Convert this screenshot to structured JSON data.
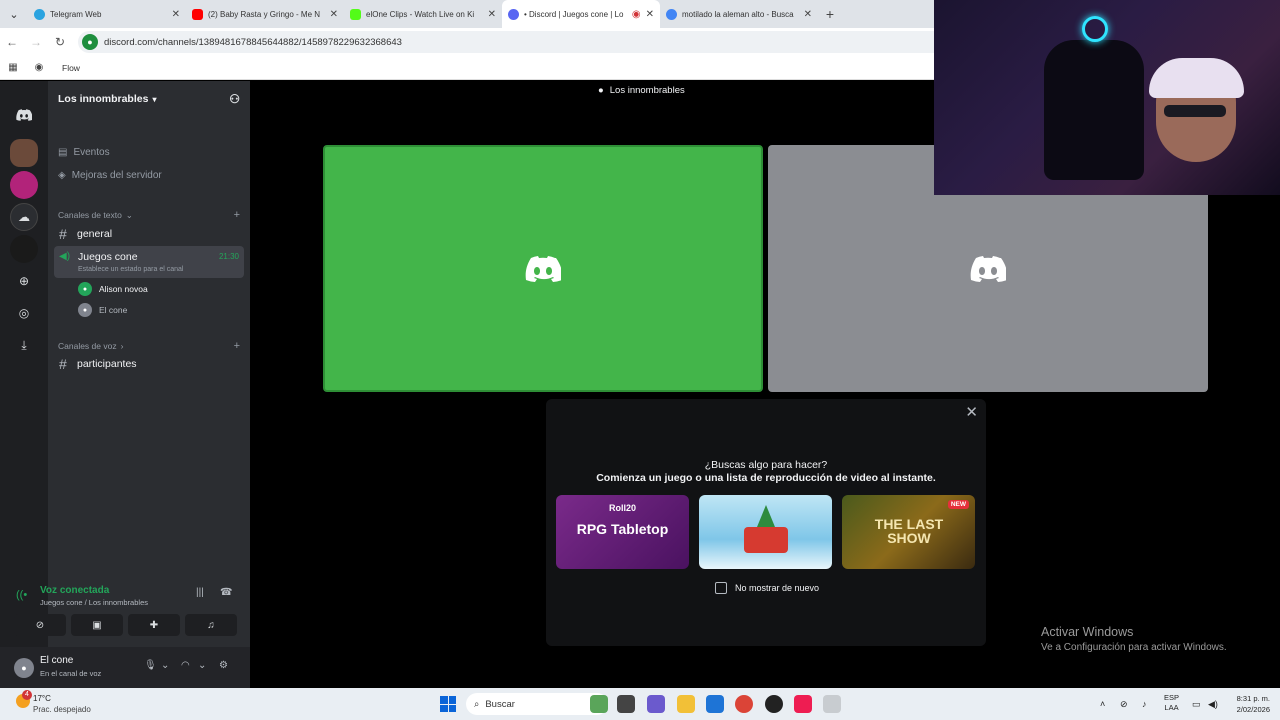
{
  "browser": {
    "tabs": [
      {
        "title": "Telegram Web",
        "color": "#2aa3e0"
      },
      {
        "title": "(2) Baby Rasta y Gringo - Me N",
        "color": "#ff0000"
      },
      {
        "title": "elOne Clips - Watch Live on Ki",
        "color": "#53fc18"
      },
      {
        "title": "• Discord | Juegos cone | Lo",
        "color": "#5865f2"
      },
      {
        "title": "motilado la aleman alto - Busca",
        "color": "#4285f4"
      }
    ],
    "url": "discord.com/channels/1389481678845644882/1458978229632368643",
    "bookmark": "Flow"
  },
  "server": {
    "name": "Los innombrables",
    "items": [
      "Eventos",
      "Mejoras del servidor"
    ],
    "text_category": "Canales de texto",
    "text_channels": [
      "general"
    ],
    "voice_channel": {
      "name": "Juegos cone",
      "time": "21:30",
      "status": "Establece un estado para el canal"
    },
    "voice_users": [
      "Alison novoa",
      "El cone"
    ],
    "voice_category": "Canales de voz",
    "voice_channels": [
      "participantes"
    ]
  },
  "voice_panel": {
    "status": "Voz conectada",
    "location": "Juegos cone / Los innombrables"
  },
  "user": {
    "name": "El cone",
    "sub": "En el canal de voz"
  },
  "call": {
    "title": "Los innombrables"
  },
  "popup": {
    "question": "¿Buscas algo para hacer?",
    "subtitle": "Comienza un juego o una lista de reproducción de video al instante.",
    "cards": [
      {
        "brand": "Roll20",
        "title": "RPG Tabletop"
      },
      {
        "title": ""
      },
      {
        "title": "THE LAST SHOW",
        "badge": "NEW"
      }
    ],
    "checkbox": "No mostrar de nuevo"
  },
  "watermark": {
    "line1": "Activar Windows",
    "line2": "Ve a Configuración para activar Windows."
  },
  "taskbar": {
    "weather_badge": "4",
    "temp": "17°C",
    "condition": "Prac. despejado",
    "search": "Buscar",
    "lang1": "ESP",
    "lang2": "LAA",
    "time": "8:31 p. m.",
    "date": "2/02/2026"
  }
}
